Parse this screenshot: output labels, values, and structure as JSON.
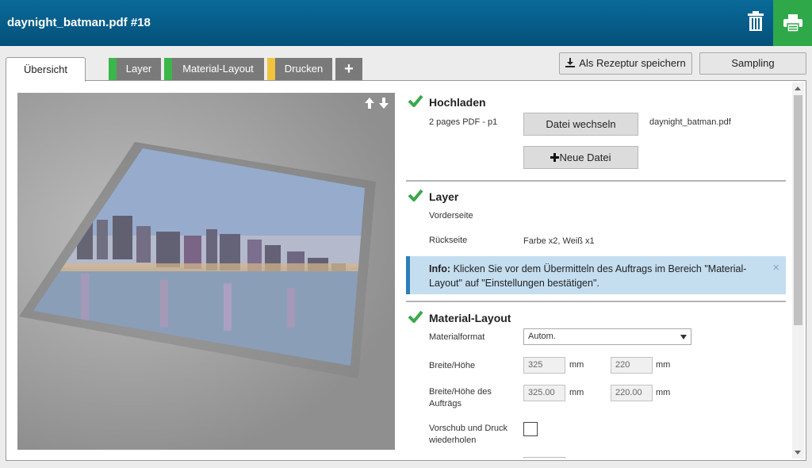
{
  "header": {
    "title": "daynight_batman.pdf #18"
  },
  "tabs": {
    "overview": "Übersicht",
    "items": [
      {
        "label": "Layer",
        "color": "#3cb54a"
      },
      {
        "label": "Material-Layout",
        "color": "#3cb54a"
      },
      {
        "label": "Drucken",
        "color": "#f2c43d"
      }
    ],
    "add": "+"
  },
  "toolbar": {
    "save_recipe": "Als Rezeptur speichern",
    "sampling": "Sampling"
  },
  "upload": {
    "title": "Hochladen",
    "pages": "2 pages PDF - p1",
    "change_button": "Datei wechseln",
    "filename": "daynight_batman.pdf",
    "new_file_button": "Neue Datei"
  },
  "layer": {
    "title": "Layer",
    "front_label": "Vorderseite",
    "back_label": "Rückseite",
    "back_value": "Farbe x2, Weiß x1"
  },
  "info": {
    "label": "Info:",
    "text": "Klicken Sie vor dem Übermitteln des Auftrags im Bereich \"Material-Layout\" auf \"Einstellungen bestätigen\".",
    "close": "×"
  },
  "material": {
    "title": "Material-Layout",
    "format_label": "Materialformat",
    "format_value": "Autom.",
    "size_label": "Breite/Höhe",
    "width": "325",
    "height": "220",
    "unit": "mm",
    "job_size_label": "Breite/Höhe des Aufträgs",
    "job_width": "325.00",
    "job_height": "220.00",
    "repeat_label": "Vorschub und Druck wiederholen"
  },
  "colors": {
    "header": "#04507a",
    "print": "#2fa84a",
    "check": "#3aa84a",
    "info_bg": "#c4def0"
  }
}
